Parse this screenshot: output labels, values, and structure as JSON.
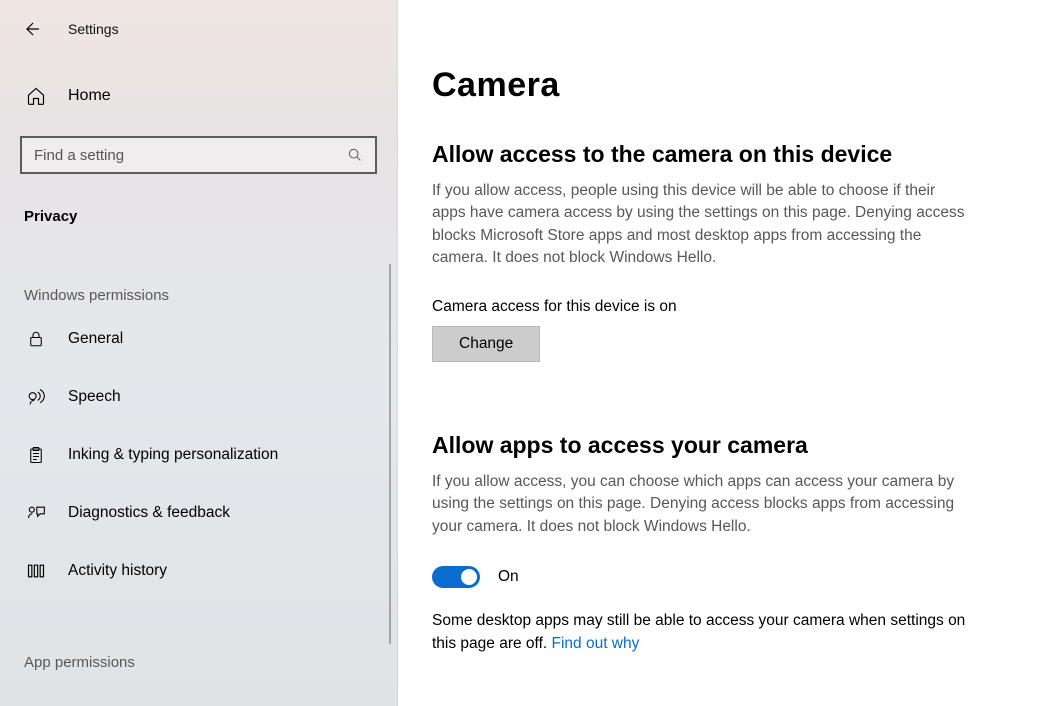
{
  "header": {
    "title": "Settings",
    "home_label": "Home"
  },
  "search": {
    "placeholder": "Find a setting"
  },
  "category": "Privacy",
  "groups": {
    "windows_permissions": {
      "label": "Windows permissions",
      "items": [
        {
          "label": "General"
        },
        {
          "label": "Speech"
        },
        {
          "label": "Inking & typing personalization"
        },
        {
          "label": "Diagnostics & feedback"
        },
        {
          "label": "Activity history"
        }
      ]
    },
    "app_permissions": {
      "label": "App permissions"
    }
  },
  "page": {
    "title": "Camera",
    "section1": {
      "heading": "Allow access to the camera on this device",
      "desc": "If you allow access, people using this device will be able to choose if their apps have camera access by using the settings on this page. Denying access blocks Microsoft Store apps and most desktop apps from accessing the camera. It does not block Windows Hello.",
      "status": "Camera access for this device is on",
      "button": "Change"
    },
    "section2": {
      "heading": "Allow apps to access your camera",
      "desc": "If you allow access, you can choose which apps can access your camera by using the settings on this page. Denying access blocks apps from accessing your camera. It does not block Windows Hello.",
      "toggle_label": "On",
      "note_pre": "Some desktop apps may still be able to access your camera when settings on this page are off. ",
      "note_link": "Find out why"
    }
  }
}
